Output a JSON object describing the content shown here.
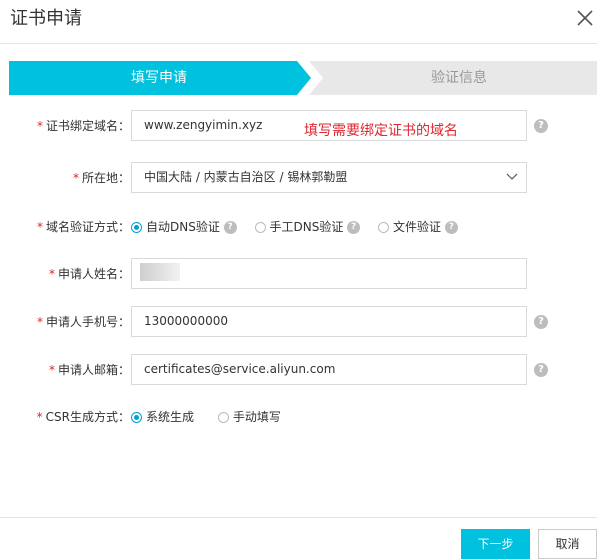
{
  "dialog": {
    "title": "证书申请",
    "close_icon": "close-icon"
  },
  "steps": [
    {
      "label": "填写申请",
      "active": true,
      "color": "#00c1de"
    },
    {
      "label": "验证信息",
      "active": false,
      "color": "#e8e8e8"
    }
  ],
  "form": {
    "domain": {
      "required_mark": "*",
      "label": "证书绑定域名：",
      "value": "www.zengyimin.xyz",
      "annotation": "填写需要绑定证书的域名",
      "help_icon": "question-icon"
    },
    "location": {
      "required_mark": "*",
      "label": "所在地：",
      "value": "中国大陆 / 内蒙古自治区 / 锡林郭勒盟",
      "dropdown_icon": "chevron-down-icon"
    },
    "verify_method": {
      "required_mark": "*",
      "label": "域名验证方式：",
      "options": [
        {
          "label": "自动DNS验证",
          "selected": true
        },
        {
          "label": "手工DNS验证",
          "selected": false
        },
        {
          "label": "文件验证",
          "selected": false
        }
      ]
    },
    "applicant_name": {
      "required_mark": "*",
      "label": "申请人姓名：",
      "value": ""
    },
    "phone": {
      "required_mark": "*",
      "label": "申请人手机号：",
      "value": "13000000000"
    },
    "email": {
      "required_mark": "*",
      "label": "申请人邮箱：",
      "value": "certificates@service.aliyun.com"
    },
    "csr": {
      "required_mark": "*",
      "label": "CSR生成方式：",
      "options": [
        {
          "label": "系统生成",
          "selected": true
        },
        {
          "label": "手动填写",
          "selected": false
        }
      ]
    },
    "help_glyph": "?"
  },
  "footer": {
    "next_label": "下一步",
    "cancel_label": "取消"
  },
  "colors": {
    "accent": "#00c1de",
    "required": "#e0262f",
    "radio_selected": "#00a2ca"
  }
}
